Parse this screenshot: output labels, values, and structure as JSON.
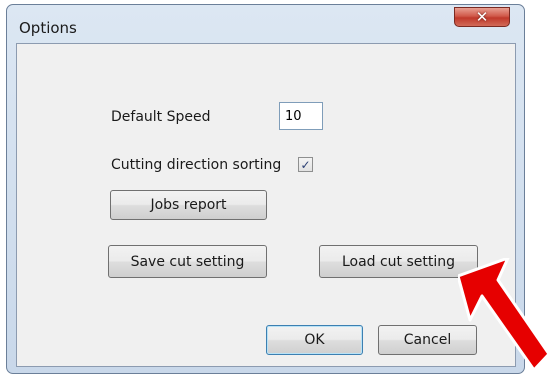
{
  "window": {
    "title": "Options",
    "close_glyph": "✕"
  },
  "form": {
    "default_speed_label": "Default Speed",
    "default_speed_value": "10",
    "cutting_direction_label": "Cutting direction sorting",
    "cutting_direction_checked": true,
    "check_glyph": "✓"
  },
  "buttons": {
    "jobs_report": "Jobs report",
    "save_cut_setting": "Save cut setting",
    "load_cut_setting": "Load cut setting",
    "ok": "OK",
    "cancel": "Cancel"
  },
  "annotation": {
    "arrow_color": "#e60000",
    "arrow_icon": "red-arrow-icon"
  },
  "colors": {
    "close_button": "#c0392b",
    "default_button_border": "#3c7fb1"
  }
}
